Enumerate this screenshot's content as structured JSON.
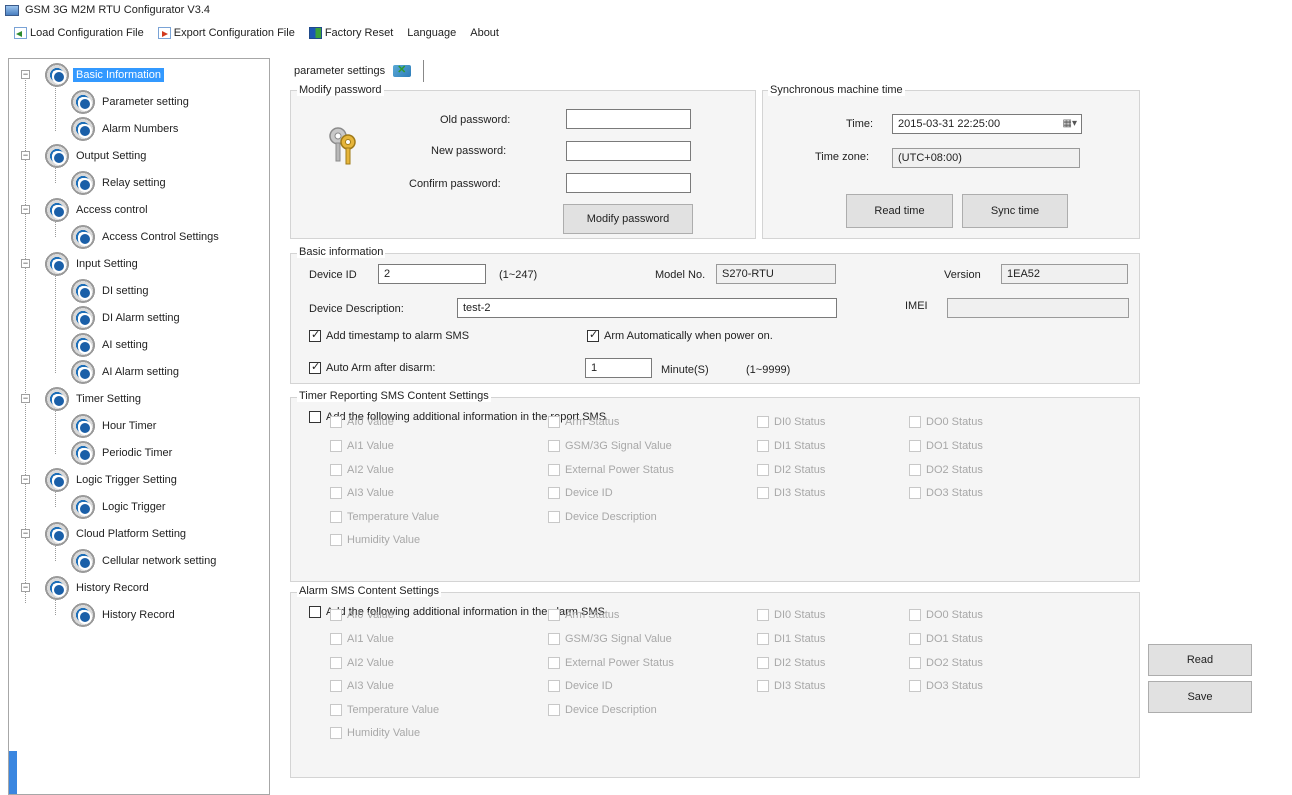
{
  "window": {
    "title": "GSM 3G M2M RTU Configurator V3.4"
  },
  "menu": {
    "load": "Load Configuration File",
    "export": "Export Configuration File",
    "reset": "Factory Reset",
    "language": "Language",
    "about": "About"
  },
  "tree": {
    "basic_information": "Basic Information",
    "parameter_setting": "Parameter setting",
    "alarm_numbers": "Alarm Numbers",
    "output_setting": "Output Setting",
    "relay_setting": "Relay setting",
    "access_control": "Access control",
    "access_control_settings": "Access Control Settings",
    "input_setting": "Input Setting",
    "di_setting": "DI setting",
    "di_alarm_setting": "DI Alarm setting",
    "ai_setting": "AI setting",
    "ai_alarm_setting": "AI Alarm setting",
    "timer_setting": "Timer Setting",
    "hour_timer": "Hour Timer",
    "periodic_timer": "Periodic Timer",
    "logic_trigger_setting": "Logic Trigger Setting",
    "logic_trigger": "Logic Trigger",
    "cloud_platform_setting": "Cloud Platform Setting",
    "cellular_network_setting": "Cellular network setting",
    "history_record_group": "History Record",
    "history_record": "History Record",
    "toggle_symbol": "−"
  },
  "tab": {
    "label": "parameter settings"
  },
  "password": {
    "title": "Modify password",
    "old": "Old password:",
    "new": "New password:",
    "confirm": "Confirm password:",
    "button": "Modify password"
  },
  "sync": {
    "title": "Synchronous machine time",
    "time_label": "Time:",
    "time_value": "2015-03-31 22:25:00",
    "dropdown_glyph": "▦▾",
    "zone_label": "Time zone:",
    "zone_value": "(UTC+08:00)",
    "read": "Read time",
    "sync": "Sync time"
  },
  "basic": {
    "title": "Basic information",
    "device_id_label": "Device ID",
    "device_id": "2",
    "device_id_range": "(1~247)",
    "model_label": "Model No.",
    "model": "S270-RTU",
    "version_label": "Version",
    "version": "1EA52",
    "desc_label": "Device Description:",
    "desc": "test-2",
    "imei_label": "IMEI",
    "imei": "",
    "ts_alarm": "Add timestamp to alarm SMS",
    "arm_power_on": "Arm Automatically when power on.",
    "auto_arm": "Auto Arm after disarm:",
    "auto_arm_value": "1",
    "minute": "Minute(S)",
    "minute_range": "(1~9999)"
  },
  "timer_sms": {
    "title": "Timer Reporting SMS Content Settings",
    "master": "Add the following additional information in the report SMS",
    "col1": [
      "AI0 Value",
      "AI1 Value",
      "AI2 Value",
      "AI3 Value",
      "Temperature Value",
      "Humidity Value"
    ],
    "col2": [
      "Arm Status",
      "GSM/3G Signal Value",
      "External Power Status",
      "Device ID",
      "Device Description"
    ],
    "col3": [
      "DI0 Status",
      "DI1 Status",
      "DI2 Status",
      "DI3 Status"
    ],
    "col4": [
      "DO0 Status",
      "DO1 Status",
      "DO2 Status",
      "DO3 Status"
    ]
  },
  "alarm_sms": {
    "title": "Alarm SMS Content Settings",
    "master": "Add the following additional information in the alarm SMS",
    "col1": [
      "AI0 Value",
      "AI1 Value",
      "AI2 Value",
      "AI3 Value",
      "Temperature Value",
      "Humidity Value"
    ],
    "col2": [
      "Arm Status",
      "GSM/3G Signal Value",
      "External Power Status",
      "Device ID",
      "Device Description"
    ],
    "col3": [
      "DI0 Status",
      "DI1 Status",
      "DI2 Status",
      "DI3 Status"
    ],
    "col4": [
      "DO0 Status",
      "DO1 Status",
      "DO2 Status",
      "DO3 Status"
    ]
  },
  "actions": {
    "read": "Read",
    "save": "Save"
  }
}
